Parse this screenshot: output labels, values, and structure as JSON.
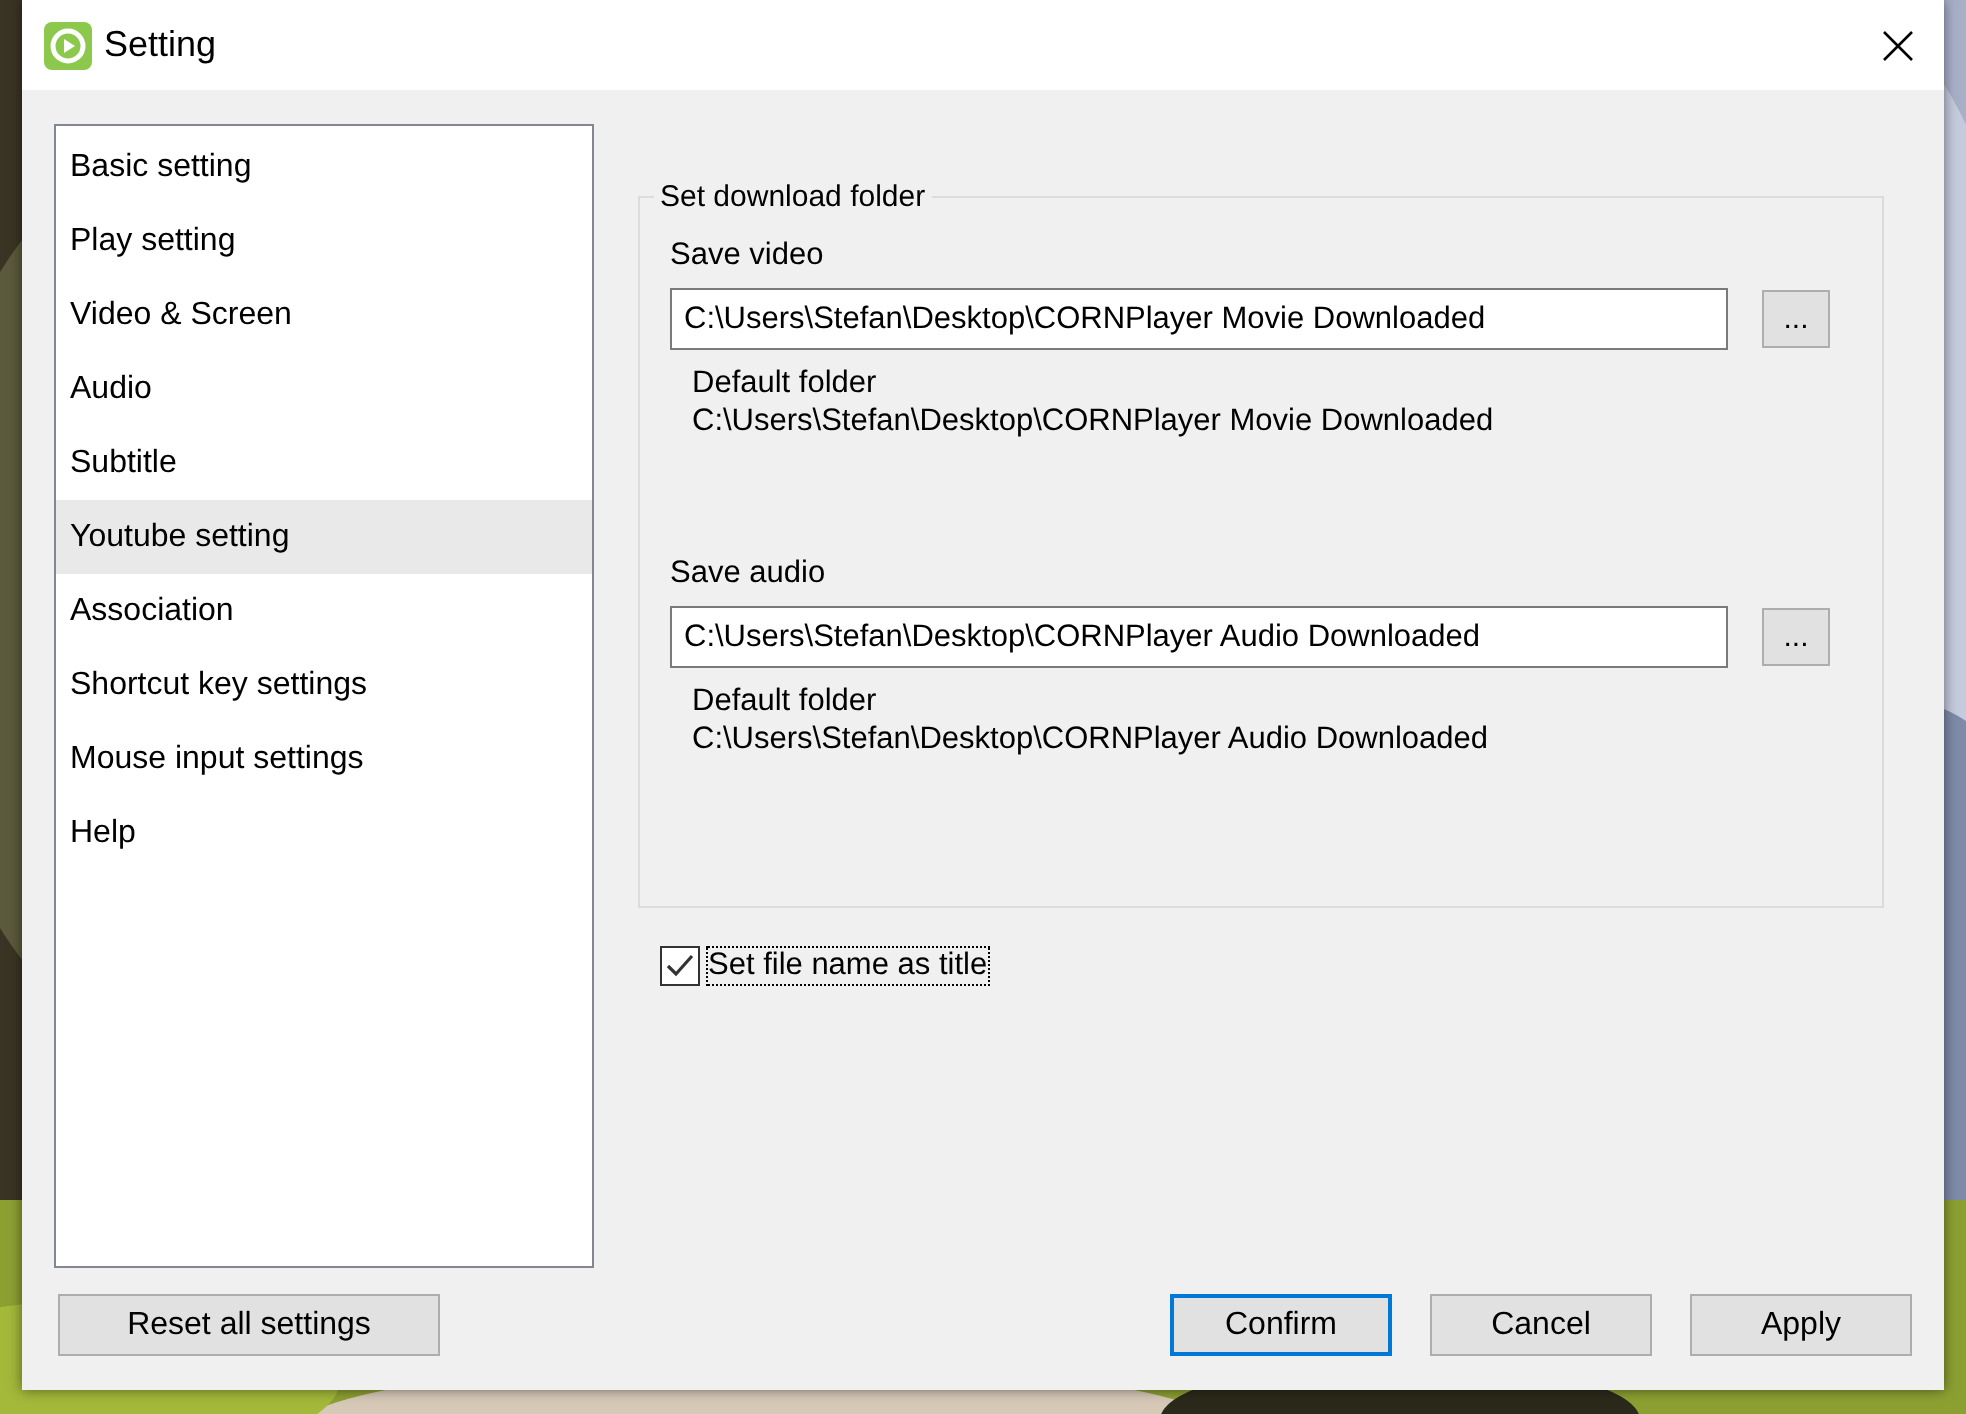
{
  "window": {
    "title": "Setting"
  },
  "sidebar": {
    "items": [
      {
        "label": "Basic setting",
        "selected": false
      },
      {
        "label": "Play setting",
        "selected": false
      },
      {
        "label": "Video & Screen",
        "selected": false
      },
      {
        "label": "Audio",
        "selected": false
      },
      {
        "label": "Subtitle",
        "selected": false
      },
      {
        "label": "Youtube setting",
        "selected": true
      },
      {
        "label": "Association",
        "selected": false
      },
      {
        "label": "Shortcut key settings",
        "selected": false
      },
      {
        "label": "Mouse input settings",
        "selected": false
      },
      {
        "label": "Help",
        "selected": false
      }
    ]
  },
  "group": {
    "title": "Set download folder",
    "folders": [
      {
        "label": "Save video",
        "value": "C:\\Users\\Stefan\\Desktop\\CORNPlayer Movie Downloaded",
        "browse": "...",
        "default_label": "Default folder",
        "default_path": "C:\\Users\\Stefan\\Desktop\\CORNPlayer Movie Downloaded"
      },
      {
        "label": "Save audio",
        "value": "C:\\Users\\Stefan\\Desktop\\CORNPlayer Audio Downloaded",
        "browse": "...",
        "default_label": "Default folder",
        "default_path": "C:\\Users\\Stefan\\Desktop\\CORNPlayer Audio Downloaded"
      }
    ]
  },
  "checkbox": {
    "label": "Set file name as title",
    "checked": true,
    "focused": true
  },
  "footer": {
    "reset": "Reset all settings",
    "actions": [
      {
        "label": "Confirm",
        "default": true
      },
      {
        "label": "Cancel",
        "default": false
      },
      {
        "label": "Apply",
        "default": false
      }
    ]
  }
}
